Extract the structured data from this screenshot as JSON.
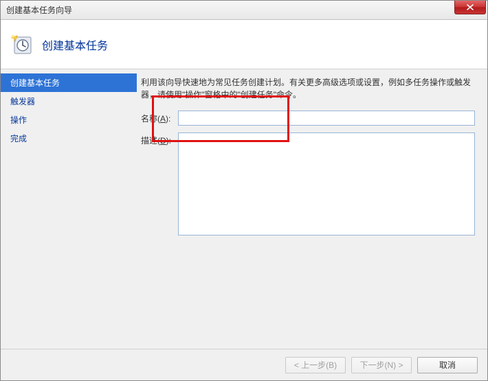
{
  "window": {
    "title": "创建基本任务向导"
  },
  "header": {
    "heading": "创建基本任务"
  },
  "sidebar": {
    "items": [
      {
        "label": "创建基本任务",
        "active": true
      },
      {
        "label": "触发器",
        "active": false
      },
      {
        "label": "操作",
        "active": false
      },
      {
        "label": "完成",
        "active": false
      }
    ]
  },
  "content": {
    "description": "利用该向导快速地为常见任务创建计划。有关更多高级选项或设置，例如多任务操作或触发器，请使用\"操作\"窗格中的\"创建任务\"命令。",
    "name_label_prefix": "名称(",
    "name_label_key": "A",
    "name_label_suffix": "):",
    "name_value": "",
    "desc_label_prefix": "描述(",
    "desc_label_key": "D",
    "desc_label_suffix": "):",
    "desc_value": ""
  },
  "footer": {
    "back_label": "< 上一步(B)",
    "next_label": "下一步(N) >",
    "cancel_label": "取消"
  },
  "icons": {
    "close": "close-icon",
    "header": "clock-new-icon"
  }
}
